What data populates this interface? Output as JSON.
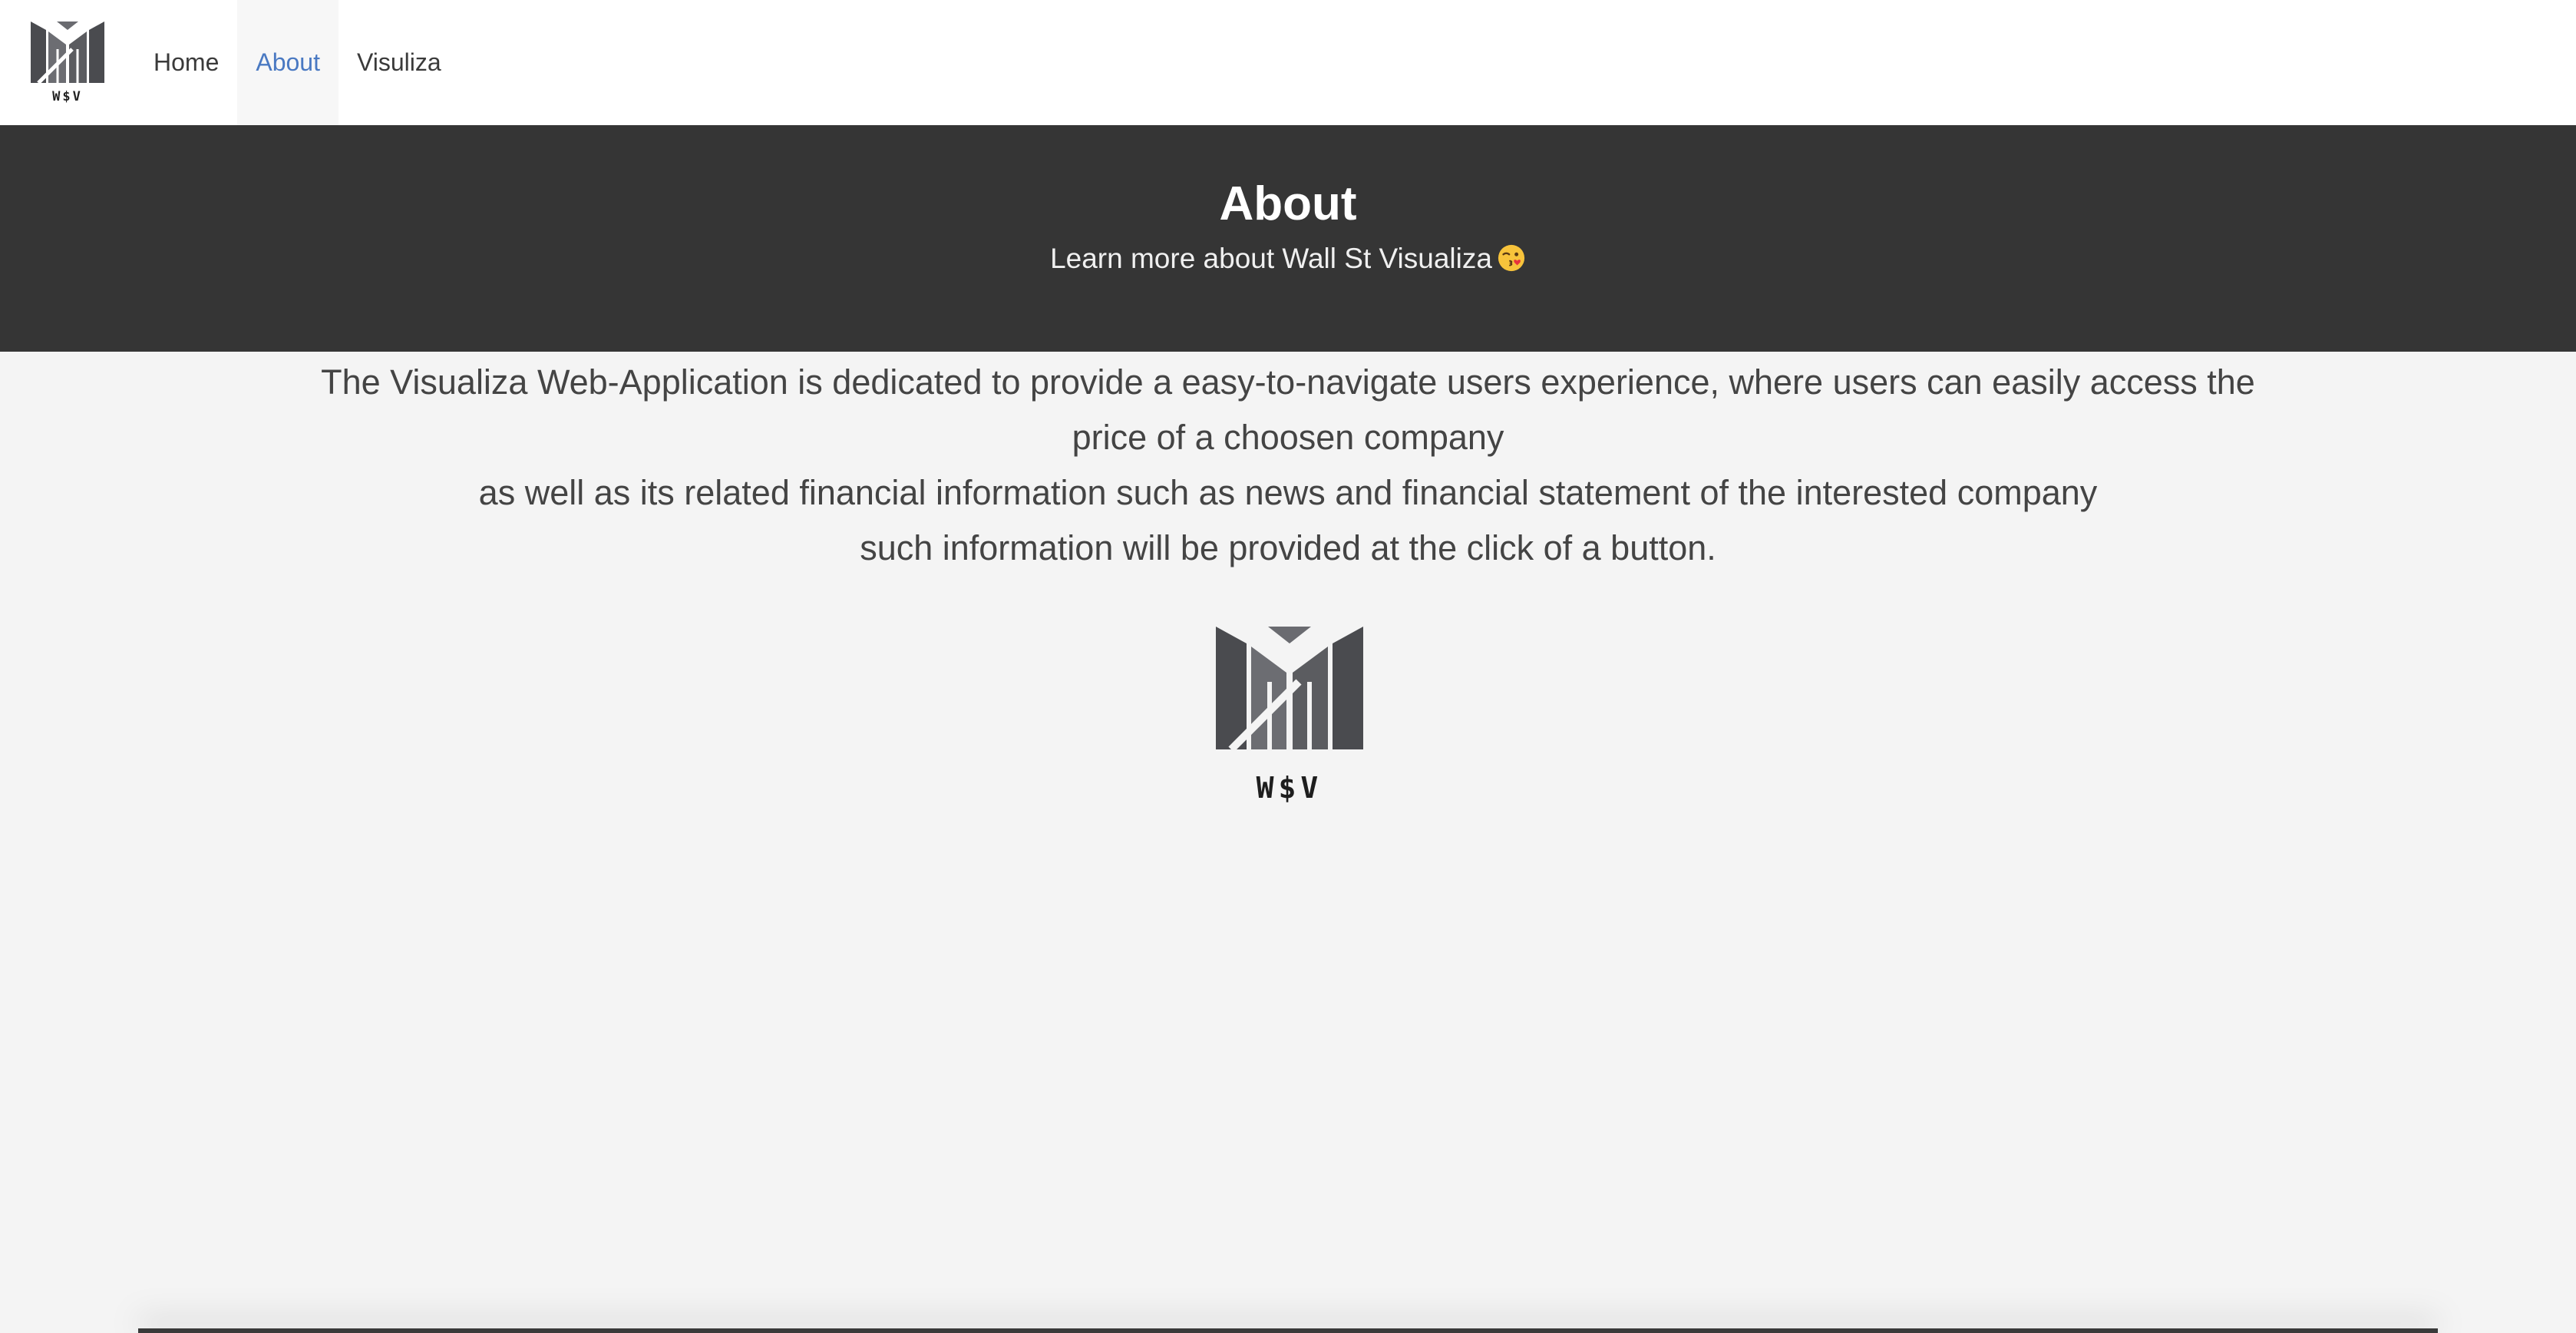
{
  "nav": {
    "logo_text": "W$V",
    "items": [
      {
        "label": "Home"
      },
      {
        "label": "About"
      },
      {
        "label": "Visuliza"
      }
    ],
    "active_color": "#4a79c2"
  },
  "hero": {
    "title": "About",
    "subtitle": "Learn more about Wall St Visualiza",
    "emoji_icon": "kissing-face-emoji",
    "background": "#353535"
  },
  "content": {
    "line1": "The Visualiza Web-Application is dedicated to provide a easy-to-navigate users experience, where users can easily access the",
    "line2": "price of a choosen company",
    "line3": "as well as its related financial information such as news and financial statement of the interested company",
    "line4": "such information will be provided at the click of a button."
  },
  "about_logo": {
    "logo_text": "W$V"
  }
}
